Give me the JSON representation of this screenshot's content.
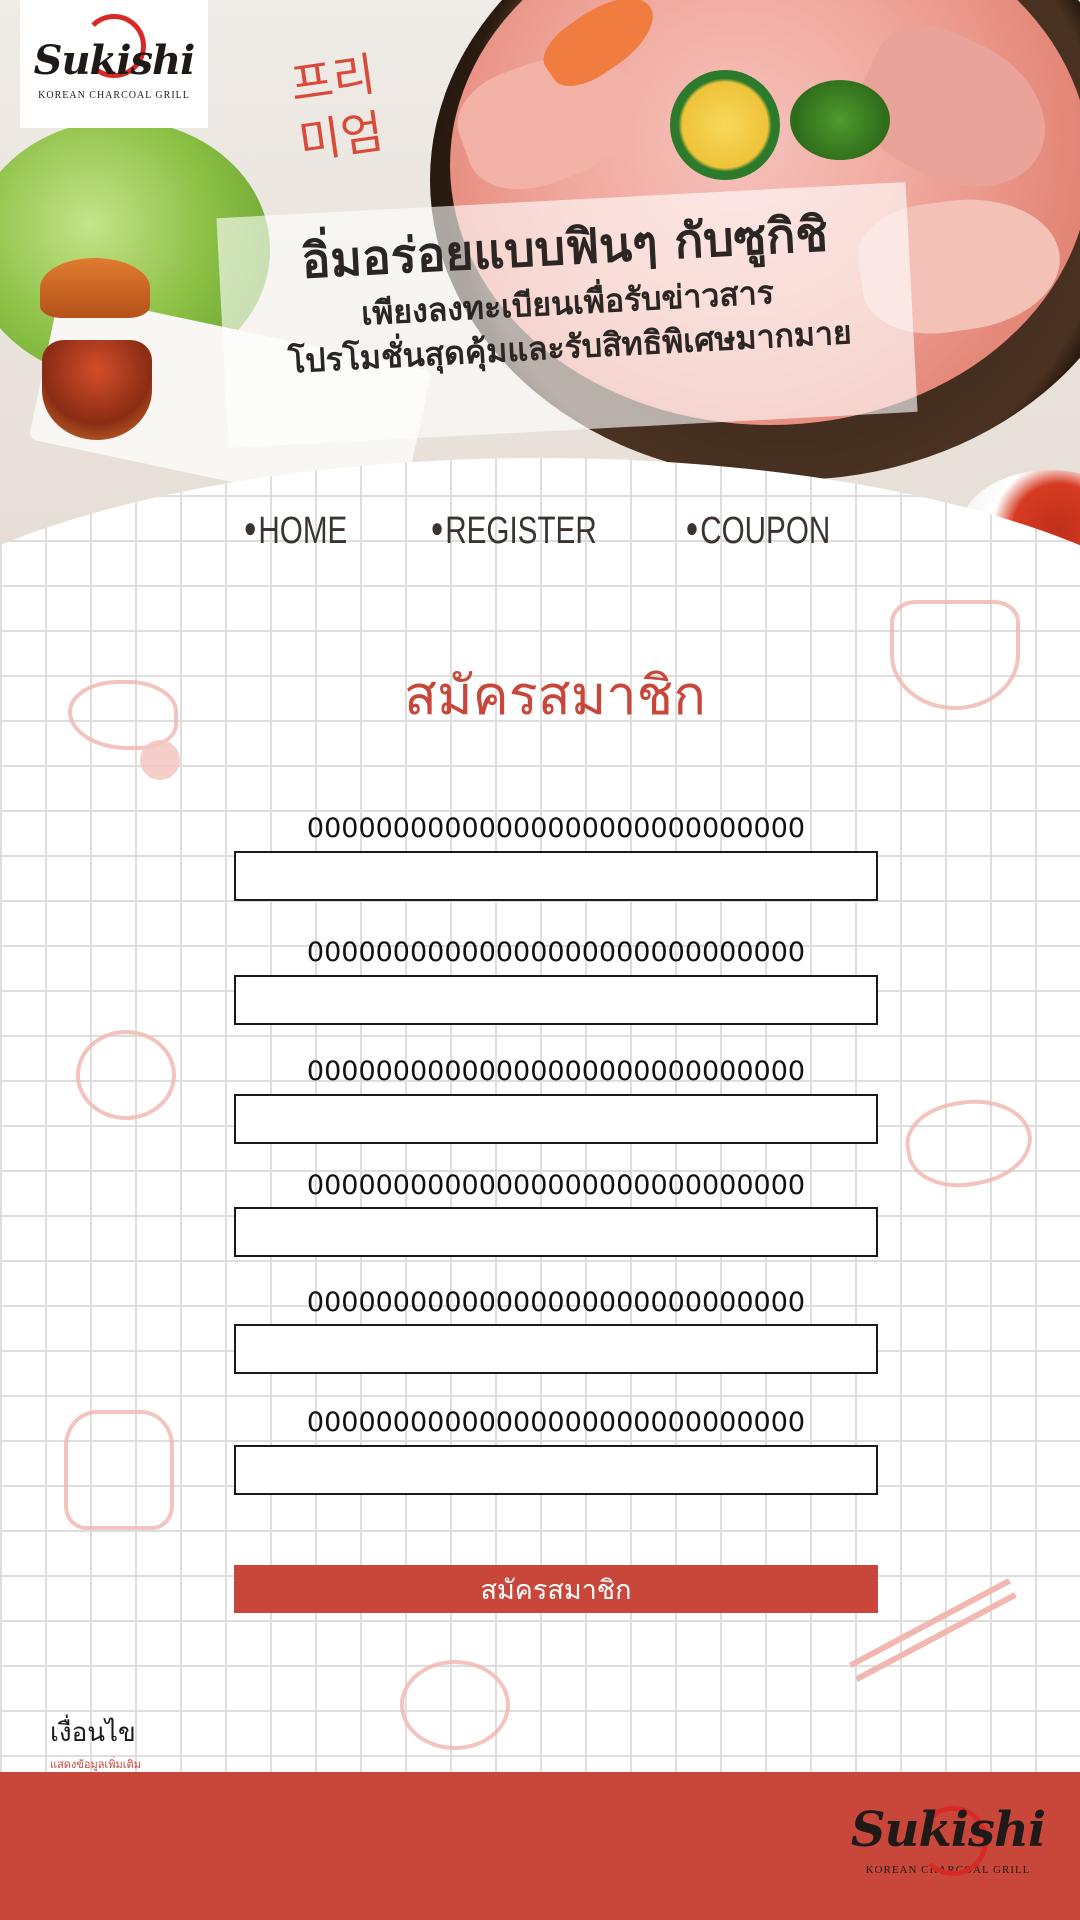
{
  "brand": {
    "logo_word": "Sukishi",
    "logo_tagline": "KOREAN CHARCOAL GRILL"
  },
  "hero": {
    "korean_text": "프리 미엄",
    "headline": "อิ่มอร่อยแบบฟินๆ กับซูกิชิ",
    "subline1": "เพียงลงทะเบียนเพื่อรับข่าวสาร",
    "subline2": "โปรโมชั่นสุดคุ้มและรับสิทธิพิเศษมากมาย"
  },
  "nav": {
    "items": [
      {
        "label": "HOME"
      },
      {
        "label": "REGISTER"
      },
      {
        "label": "COUPON"
      }
    ]
  },
  "form": {
    "title": "สมัครสมาชิก",
    "fields": [
      {
        "label": "00000000000000000000000000000",
        "value": ""
      },
      {
        "label": "00000000000000000000000000000",
        "value": ""
      },
      {
        "label": "00000000000000000000000000000",
        "value": ""
      },
      {
        "label": "00000000000000000000000000000",
        "value": ""
      },
      {
        "label": "00000000000000000000000000000",
        "value": ""
      },
      {
        "label": "00000000000000000000000000000",
        "value": ""
      }
    ],
    "submit_label": "สมัครสมาชิก"
  },
  "terms": {
    "title": "เงื่อนไข",
    "subtitle": "แสดงข้อมูลเพิ่มเติม"
  },
  "colors": {
    "accent": "#c8473a",
    "logo_red": "#d72a26",
    "text_dark": "#1f1a17"
  }
}
